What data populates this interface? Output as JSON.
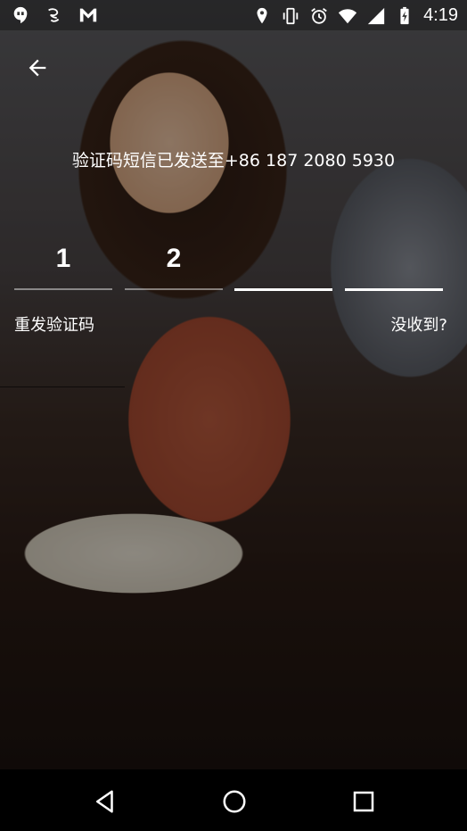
{
  "status_bar": {
    "time": "4:19",
    "left_icons": [
      "hangouts-icon",
      "weibo-icon",
      "gmail-icon"
    ],
    "right_icons": [
      "location-icon",
      "vibrate-icon",
      "alarm-icon",
      "wifi-icon",
      "signal-icon",
      "battery-charging-icon"
    ]
  },
  "header": {
    "back_icon": "arrow-left-icon"
  },
  "verification": {
    "message": "验证码短信已发送至+86 187 2080 5930",
    "digits": [
      "1",
      "2",
      "",
      ""
    ]
  },
  "actions": {
    "resend_label": "重发验证码",
    "not_received_label": "没收到?"
  },
  "nav": {
    "back": "triangle-back-icon",
    "home": "circle-home-icon",
    "recents": "square-recents-icon"
  },
  "colors": {
    "text": "#ffffff",
    "overlay": "#000000",
    "navbar": "#000000"
  }
}
